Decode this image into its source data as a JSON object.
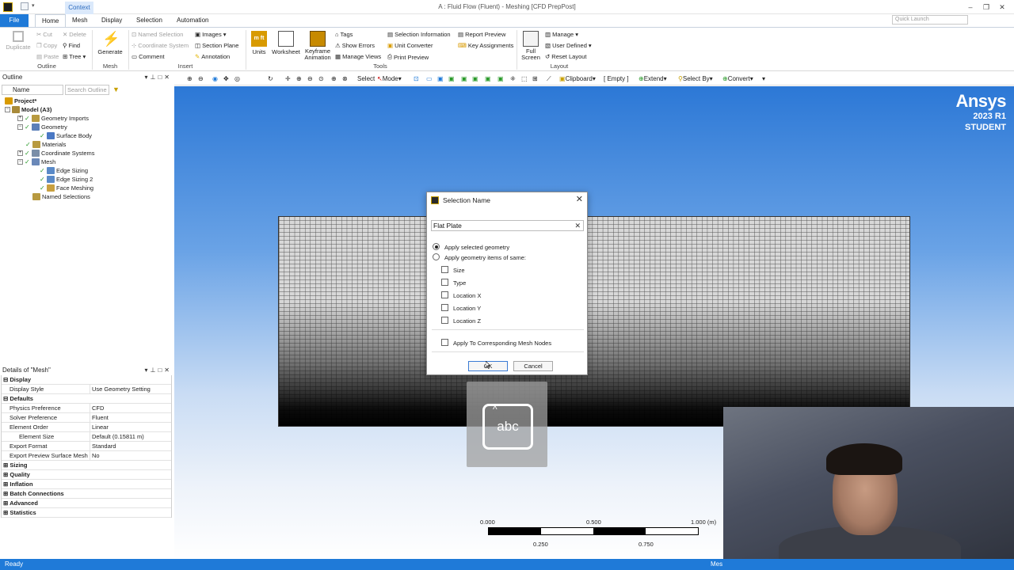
{
  "window": {
    "title": "A : Fluid Flow (Fluent) - Meshing [CFD PrepPost]",
    "context_tab": "Context",
    "quick_launch_placeholder": "Quick Launch",
    "controls": [
      "–",
      "❐",
      "✕"
    ]
  },
  "menu": {
    "file": "File",
    "tabs": [
      "Home",
      "Mesh",
      "Display",
      "Selection",
      "Automation"
    ],
    "active_tab": "Home"
  },
  "ribbon": {
    "outline": {
      "label": "Outline",
      "duplicate": "Duplicate",
      "cut": "Cut",
      "copy": "Copy",
      "paste": "Paste",
      "delete": "Delete",
      "find": "Find",
      "tree": "Tree"
    },
    "mesh": {
      "label": "Mesh",
      "generate": "Generate"
    },
    "insert": {
      "label": "Insert",
      "named_selection": "Named Selection",
      "coordinate_system": "Coordinate System",
      "comment": "Comment",
      "images": "Images",
      "section_plane": "Section Plane",
      "annotation": "Annotation"
    },
    "tools": {
      "label": "Tools",
      "units": "Units",
      "worksheet": "Worksheet",
      "keyframe_animation": "Keyframe Animation",
      "tags": "Tags",
      "show_errors": "Show Errors",
      "manage_views": "Manage Views",
      "selection_information": "Selection Information",
      "unit_converter": "Unit Converter",
      "print_preview": "Print Preview",
      "report_preview": "Report Preview",
      "key_assignments": "Key Assignments"
    },
    "layout": {
      "label": "Layout",
      "full_screen": "Full Screen",
      "manage": "Manage",
      "user_defined": "User Defined",
      "reset_layout": "Reset Layout"
    }
  },
  "outline": {
    "title": "Outline",
    "name_dropdown": "Name",
    "search_placeholder": "Search Outline",
    "tree": [
      {
        "label": "Project*",
        "bold": true
      },
      {
        "label": "Model (A3)",
        "bold": true
      },
      {
        "label": "Geometry Imports"
      },
      {
        "label": "Geometry"
      },
      {
        "label": "Surface Body"
      },
      {
        "label": "Materials"
      },
      {
        "label": "Coordinate Systems"
      },
      {
        "label": "Mesh"
      },
      {
        "label": "Edge Sizing"
      },
      {
        "label": "Edge Sizing 2"
      },
      {
        "label": "Face Meshing"
      },
      {
        "label": "Named Selections"
      }
    ]
  },
  "details": {
    "title": "Details of \"Mesh\"",
    "rows": [
      {
        "section": "Display"
      },
      {
        "k": "Display Style",
        "v": "Use Geometry Setting"
      },
      {
        "section": "Defaults"
      },
      {
        "k": "Physics Preference",
        "v": "CFD"
      },
      {
        "k": "Solver Preference",
        "v": "Fluent"
      },
      {
        "k": "Element Order",
        "v": "Linear"
      },
      {
        "k": "Element Size",
        "v": "Default (0.15811 m)"
      },
      {
        "k": "Export Format",
        "v": "Standard"
      },
      {
        "k": "Export Preview Surface Mesh",
        "v": "No"
      },
      {
        "section": "Sizing"
      },
      {
        "section": "Quality"
      },
      {
        "section": "Inflation"
      },
      {
        "section": "Batch Connections"
      },
      {
        "section": "Advanced"
      },
      {
        "section": "Statistics"
      }
    ]
  },
  "graphics_toolbar": {
    "select": "Select",
    "mode": "Mode",
    "clipboard": "Clipboard",
    "empty": "[ Empty ]",
    "extend": "Extend",
    "select_by": "Select By",
    "convert": "Convert"
  },
  "viewport": {
    "brand_name": "Ansys",
    "brand_version": "2023 R1",
    "brand_edition": "STUDENT",
    "keyboard_overlay": "abc",
    "scale": {
      "l0": "0.000",
      "l1": "0.500",
      "l2": "1.000 (m)",
      "l3": "0.250",
      "l4": "0.750"
    }
  },
  "dialog": {
    "title": "Selection Name",
    "name_value": "Flat Plate",
    "apply_selected": "Apply selected geometry",
    "apply_same": "Apply geometry items of same:",
    "selected_option": "apply_selected",
    "checks": [
      "Size",
      "Type",
      "Location X",
      "Location Y",
      "Location Z"
    ],
    "mesh_nodes": "Apply To Corresponding Mesh Nodes",
    "ok": "OK",
    "cancel": "Cancel"
  },
  "status": {
    "left": "Ready",
    "right": "Mes"
  },
  "colors": {
    "accent": "#1f7ad8",
    "viewport_top": "#2c78d6",
    "status_bar": "#1f7ad8"
  }
}
